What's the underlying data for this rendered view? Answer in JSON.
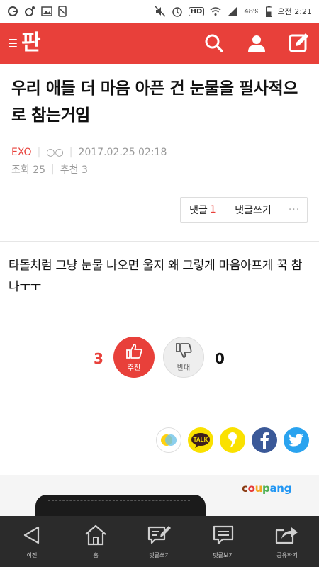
{
  "status_bar": {
    "battery": "48%",
    "time": "오전 2:21",
    "hd": "HD"
  },
  "header": {
    "logo": "판",
    "icons": [
      "search-icon",
      "user-icon",
      "write-icon"
    ]
  },
  "post": {
    "title": "우리 애들 더 마음 아픈 건 눈물을 필사적으로 참는거임",
    "category": "EXO",
    "author": "○○",
    "datetime": "2017.02.25 02:18",
    "views_label": "조회",
    "views": "25",
    "recommend_label": "추천",
    "recommend": "3",
    "body": "타돌처럼 그냥 눈물 나오면 울지 왜 그렇게 마음아프게 꾹 참나ㅜㅜ"
  },
  "comment_buttons": {
    "comments_label": "댓글",
    "comments_count": "1",
    "write_label": "댓글쓰기",
    "more": "···"
  },
  "vote": {
    "up_count": "3",
    "up_label": "추천",
    "down_label": "반대",
    "down_count": "0"
  },
  "share_icons": [
    "kakaostory-icon",
    "kakaotalk-icon",
    "kakao-icon",
    "facebook-icon",
    "twitter-icon"
  ],
  "ad": {
    "brand_parts": [
      "c",
      "o",
      "u",
      "p",
      "ang"
    ]
  },
  "bottom_nav": [
    {
      "label": "이전",
      "icon": "back-icon"
    },
    {
      "label": "홈",
      "icon": "home-icon"
    },
    {
      "label": "댓글쓰기",
      "icon": "write-comment-icon"
    },
    {
      "label": "댓글보기",
      "icon": "view-comments-icon"
    },
    {
      "label": "공유하기",
      "icon": "share-icon"
    }
  ],
  "colors": {
    "brand": "#e8403a",
    "bottom_bar": "#2b2b2b"
  }
}
